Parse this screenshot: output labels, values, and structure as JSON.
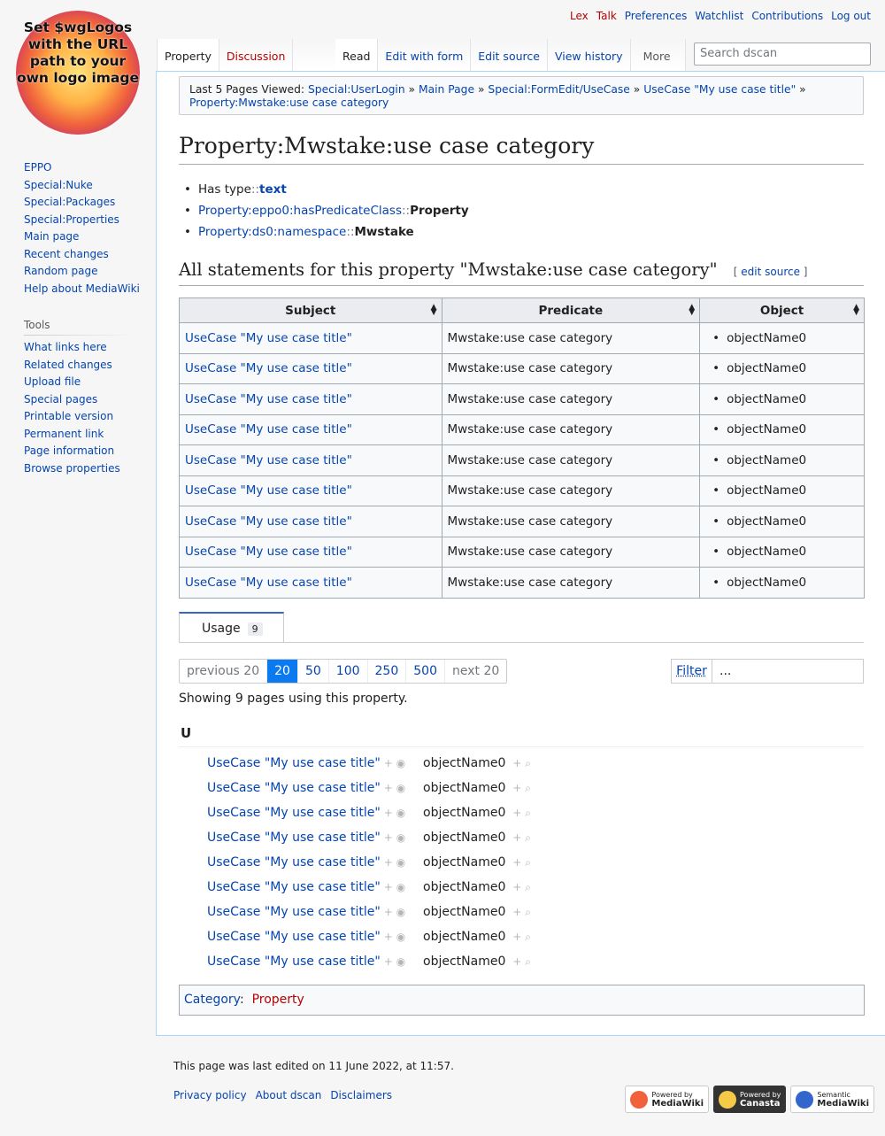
{
  "logo": {
    "text": "Set $wgLogos with the URL path to your own logo image"
  },
  "personal_tools": [
    {
      "label": "Lex",
      "red": true
    },
    {
      "label": "Talk",
      "red": true
    },
    {
      "label": "Preferences",
      "red": false
    },
    {
      "label": "Watchlist",
      "red": false
    },
    {
      "label": "Contributions",
      "red": false
    },
    {
      "label": "Log out",
      "red": false
    }
  ],
  "navigation": [
    "EPPO",
    "Special:Nuke",
    "Special:Packages",
    "Special:Properties",
    "Main page",
    "Recent changes",
    "Random page",
    "Help about MediaWiki"
  ],
  "tools": {
    "heading": "Tools",
    "items": [
      "What links here",
      "Related changes",
      "Upload file",
      "Special pages",
      "Printable version",
      "Permanent link",
      "Page information",
      "Browse properties"
    ]
  },
  "tabs": {
    "left": [
      "Property",
      "Discussion"
    ],
    "right": [
      "Read",
      "Edit with form",
      "Edit source",
      "View history"
    ],
    "more": "More"
  },
  "search": {
    "placeholder": "Search dscan"
  },
  "breadcrumbs": {
    "prefix": "Last 5 Pages Viewed:",
    "items": [
      "Special:UserLogin",
      "Main Page",
      "Special:FormEdit/UseCase",
      "UseCase \"My use case title\"",
      "Property:Mwstake:use case category"
    ],
    "separator": "»"
  },
  "page_title": "Property:Mwstake:use case category",
  "properties": [
    {
      "key": "Has type",
      "value": "text",
      "key_link": false,
      "value_link": true
    },
    {
      "key": "Property:eppo0:hasPredicateClass",
      "value": "Property",
      "key_link": true,
      "value_link": false
    },
    {
      "key": "Property:ds0:namespace",
      "value": "Mwstake",
      "key_link": true,
      "value_link": false
    }
  ],
  "property_separator": "::",
  "statements": {
    "heading": "All statements for this property \"Mwstake:use case category\"",
    "edit_label": "edit source",
    "columns": [
      "Subject",
      "Predicate",
      "Object"
    ],
    "rows": [
      [
        "UseCase \"My use case title\"",
        "Mwstake:use case category",
        "objectName0"
      ],
      [
        "UseCase \"My use case title\"",
        "Mwstake:use case category",
        "objectName0"
      ],
      [
        "UseCase \"My use case title\"",
        "Mwstake:use case category",
        "objectName0"
      ],
      [
        "UseCase \"My use case title\"",
        "Mwstake:use case category",
        "objectName0"
      ],
      [
        "UseCase \"My use case title\"",
        "Mwstake:use case category",
        "objectName0"
      ],
      [
        "UseCase \"My use case title\"",
        "Mwstake:use case category",
        "objectName0"
      ],
      [
        "UseCase \"My use case title\"",
        "Mwstake:use case category",
        "objectName0"
      ],
      [
        "UseCase \"My use case title\"",
        "Mwstake:use case category",
        "objectName0"
      ],
      [
        "UseCase \"My use case title\"",
        "Mwstake:use case category",
        "objectName0"
      ]
    ]
  },
  "usage": {
    "tab_label": "Usage",
    "count": "9",
    "pager": [
      "previous 20",
      "20",
      "50",
      "100",
      "250",
      "500",
      "next 20"
    ],
    "active_page": "20",
    "filter_label": "Filter",
    "filter_value": "...",
    "showing": "Showing 9 pages using this property.",
    "letter": "U",
    "rows": [
      {
        "subject": "UseCase \"My use case title\"",
        "object": "objectName0"
      },
      {
        "subject": "UseCase \"My use case title\"",
        "object": "objectName0"
      },
      {
        "subject": "UseCase \"My use case title\"",
        "object": "objectName0"
      },
      {
        "subject": "UseCase \"My use case title\"",
        "object": "objectName0"
      },
      {
        "subject": "UseCase \"My use case title\"",
        "object": "objectName0"
      },
      {
        "subject": "UseCase \"My use case title\"",
        "object": "objectName0"
      },
      {
        "subject": "UseCase \"My use case title\"",
        "object": "objectName0"
      },
      {
        "subject": "UseCase \"My use case title\"",
        "object": "objectName0"
      },
      {
        "subject": "UseCase \"My use case title\"",
        "object": "objectName0"
      }
    ]
  },
  "category": {
    "label": "Category",
    "value": "Property"
  },
  "footer": {
    "last_edited": "This page was last edited on 11 June 2022, at 11:57.",
    "places": [
      "Privacy policy",
      "About dscan",
      "Disclaimers"
    ],
    "badges": [
      {
        "top": "Powered by",
        "bottom": "MediaWiki",
        "icon": "mediawiki-icon"
      },
      {
        "top": "Powered by",
        "bottom": "Canasta",
        "icon": "canasta-icon"
      },
      {
        "top": "Semantic",
        "bottom": "MediaWiki",
        "icon": "semantic-mediawiki-icon"
      }
    ]
  },
  "colors": {
    "link": "#0645ad",
    "redlink": "#ba0000",
    "active_page": "#0b7af0"
  }
}
